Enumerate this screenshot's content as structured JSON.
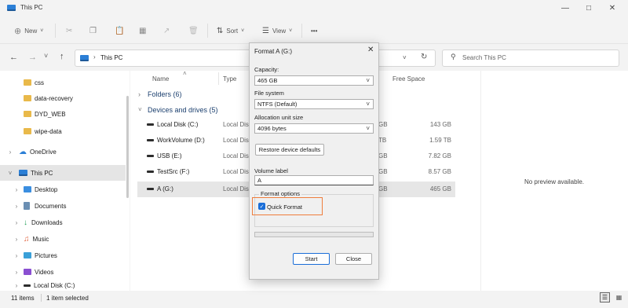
{
  "window": {
    "title": "This PC"
  },
  "toolbar": {
    "new_label": "New",
    "sort_label": "Sort",
    "view_label": "View",
    "more_label": "•••"
  },
  "address": {
    "location": "This PC",
    "search_placeholder": "Search This PC"
  },
  "sidebar": {
    "items": [
      {
        "label": "css",
        "icon": "folder-icon"
      },
      {
        "label": "data-recovery",
        "icon": "folder-icon"
      },
      {
        "label": "DYD_WEB",
        "icon": "folder-icon"
      },
      {
        "label": "wipe-data",
        "icon": "folder-icon"
      },
      {
        "label": "OneDrive",
        "icon": "cloud-icon"
      },
      {
        "label": "This PC",
        "icon": "pc-icon"
      },
      {
        "label": "Desktop",
        "icon": "desktop-icon"
      },
      {
        "label": "Documents",
        "icon": "documents-icon"
      },
      {
        "label": "Downloads",
        "icon": "download-icon"
      },
      {
        "label": "Music",
        "icon": "music-icon"
      },
      {
        "label": "Pictures",
        "icon": "pictures-icon"
      },
      {
        "label": "Videos",
        "icon": "videos-icon"
      },
      {
        "label": "Local Disk (C:)",
        "icon": "drive-icon"
      }
    ]
  },
  "columns": {
    "name": "Name",
    "type": "Type",
    "free": "Free Space"
  },
  "groups": {
    "folders": "Folders (6)",
    "devices": "Devices and drives (5)"
  },
  "drives": [
    {
      "name": "Local Disk (C:)",
      "type": "Local Disk",
      "free": "143 GB",
      "total_partial": "GB"
    },
    {
      "name": "WorkVolume (D:)",
      "type": "Local Disk",
      "free": "1.59 TB",
      "total_partial": "TB"
    },
    {
      "name": "USB (E:)",
      "type": "Local Disk",
      "free": "7.82 GB",
      "total_partial": "GB"
    },
    {
      "name": "TestSrc (F:)",
      "type": "Local Disk",
      "free": "8.57 GB",
      "total_partial": "GB"
    },
    {
      "name": "A (G:)",
      "type": "Local Disk",
      "free": "465 GB",
      "total_partial": "GB"
    }
  ],
  "preview": {
    "text": "No preview available."
  },
  "status": {
    "items": "11 items",
    "selected": "1 item selected"
  },
  "dialog": {
    "title": "Format A (G:)",
    "capacity_label": "Capacity:",
    "capacity_value": "465 GB",
    "fs_label": "File system",
    "fs_value": "NTFS (Default)",
    "alloc_label": "Allocation unit size",
    "alloc_value": "4096 bytes",
    "restore_label": "Restore device defaults",
    "volume_label": "Volume label",
    "volume_value": "A",
    "options_label": "Format options",
    "quick_format_label": "Quick Format",
    "quick_format_checked": true,
    "progress": 0,
    "start_label": "Start",
    "close_label": "Close"
  }
}
